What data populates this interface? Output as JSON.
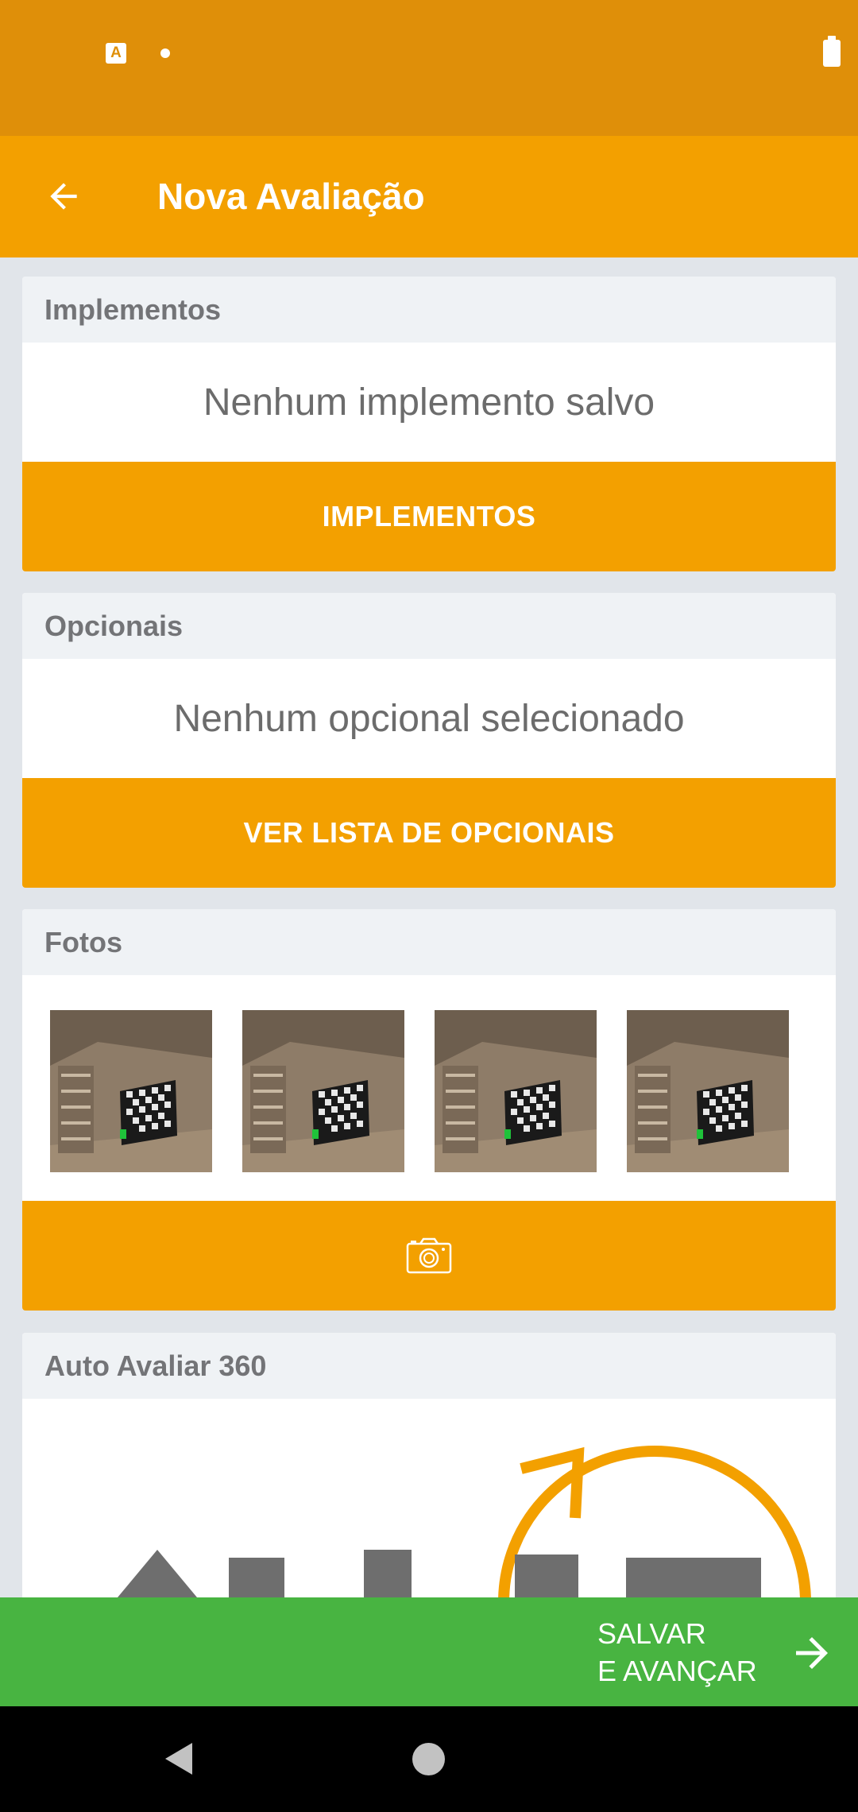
{
  "status_bar": {
    "icons": [
      "sim-card-a-icon",
      "notification-dot-icon",
      "battery-icon"
    ],
    "sim_letter": "A"
  },
  "app_bar": {
    "back_icon": "arrow-left-icon",
    "title": "Nova Avaliação",
    "color": "#f3a000"
  },
  "implementos": {
    "header": "Implementos",
    "empty_text": "Nenhum implemento salvo",
    "button_label": "IMPLEMENTOS"
  },
  "opcionais": {
    "header": "Opcionais",
    "empty_text": "Nenhum opcional selecionado",
    "button_label": "VER LISTA DE OPCIONAIS"
  },
  "fotos": {
    "header": "Fotos",
    "photos": [
      {
        "name": "photo-thumbnail-1"
      },
      {
        "name": "photo-thumbnail-2"
      },
      {
        "name": "photo-thumbnail-3"
      },
      {
        "name": "photo-thumbnail-4"
      }
    ],
    "button_icon": "camera-icon"
  },
  "auto_avaliar": {
    "header": "Auto Avaliar 360",
    "logo_icon": "auto-avaliar-360-logo"
  },
  "save_bar": {
    "label": "SALVAR\nE AVANÇAR",
    "icon": "arrow-right-icon",
    "color": "#48b441"
  },
  "nav_bar": {
    "icons": [
      "nav-back-icon",
      "nav-home-icon"
    ]
  }
}
